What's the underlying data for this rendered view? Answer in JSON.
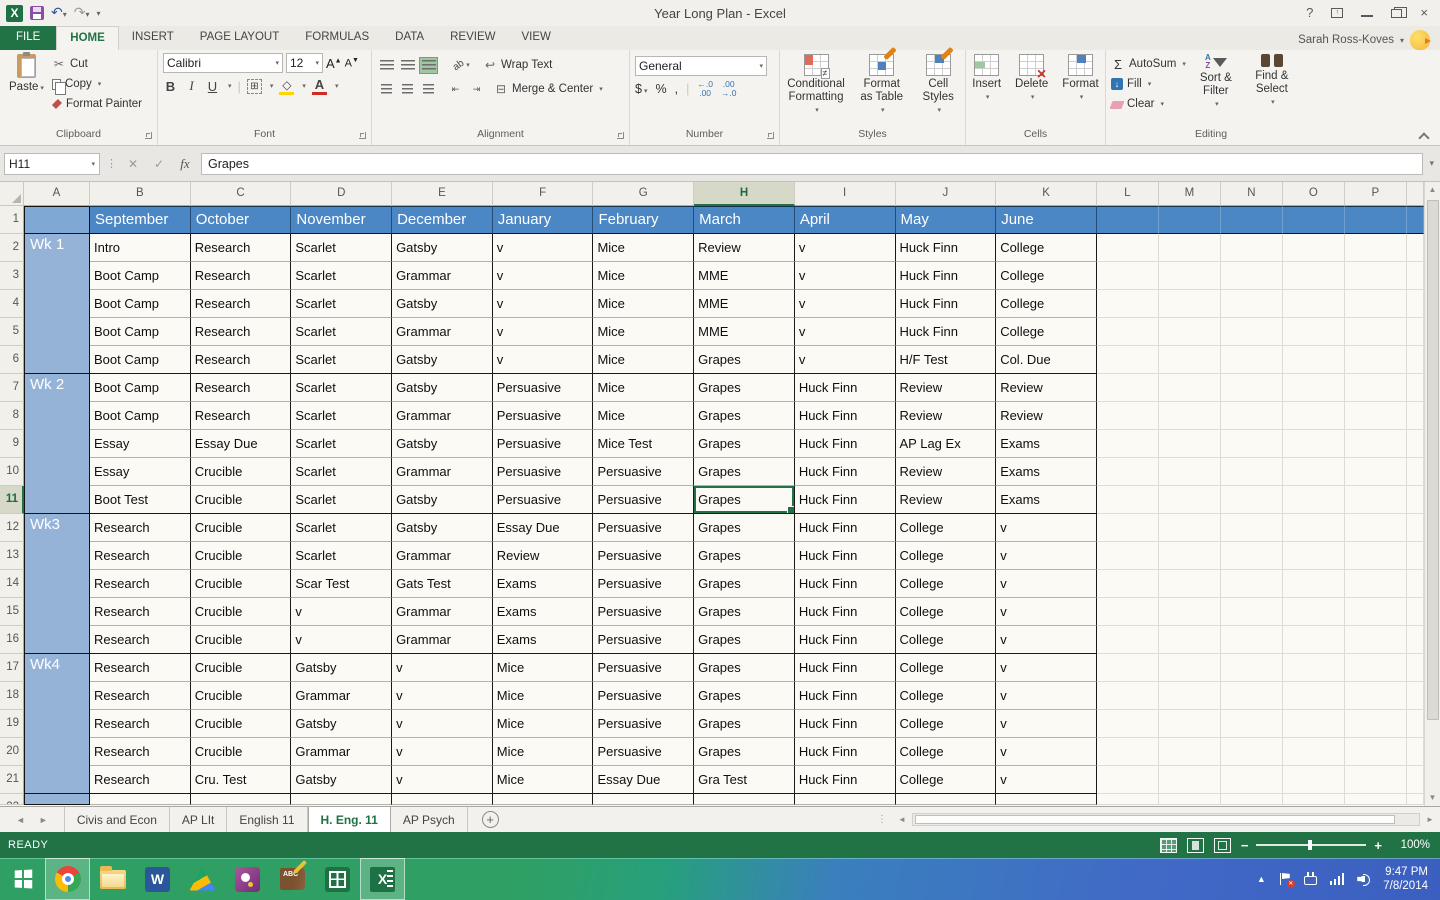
{
  "title_bar": {
    "title": "Year Long Plan - Excel",
    "help": "?",
    "user_name": "Sarah Ross-Koves"
  },
  "ribbon_tabs": {
    "file": "FILE",
    "tabs": [
      "HOME",
      "INSERT",
      "PAGE LAYOUT",
      "FORMULAS",
      "DATA",
      "REVIEW",
      "VIEW"
    ],
    "active": "HOME"
  },
  "ribbon": {
    "clipboard": {
      "label": "Clipboard",
      "paste": "Paste",
      "cut": "Cut",
      "copy": "Copy",
      "format_painter": "Format Painter"
    },
    "font": {
      "label": "Font",
      "family": "Calibri",
      "size": "12",
      "bold": "B",
      "italic": "I",
      "underline": "U"
    },
    "alignment": {
      "label": "Alignment",
      "wrap_text": "Wrap Text",
      "merge_center": "Merge & Center",
      "orientation": "ab"
    },
    "number": {
      "label": "Number",
      "format": "General",
      "currency": "$",
      "percent": "%",
      "comma": ","
    },
    "styles": {
      "label": "Styles",
      "conditional": "Conditional Formatting",
      "format_table": "Format as Table",
      "cell_styles": "Cell Styles"
    },
    "cells": {
      "label": "Cells",
      "insert": "Insert",
      "delete": "Delete",
      "format": "Format"
    },
    "editing": {
      "label": "Editing",
      "autosum": "AutoSum",
      "fill": "Fill",
      "clear": "Clear",
      "sort_filter": "Sort & Filter",
      "find_select": "Find & Select"
    }
  },
  "formula_bar": {
    "name_box": "H11",
    "value": "Grapes"
  },
  "sheet": {
    "column_letters": [
      "A",
      "B",
      "C",
      "D",
      "E",
      "F",
      "G",
      "H",
      "I",
      "J",
      "K",
      "L",
      "M",
      "N",
      "O",
      "P"
    ],
    "selected_column": "H",
    "selected_row": 11,
    "months": [
      "September",
      "October",
      "November",
      "December",
      "January",
      "February",
      "March",
      "April",
      "May",
      "June"
    ],
    "weeks": [
      {
        "label": "Wk 1",
        "rows": [
          [
            "Intro",
            "Research",
            "Scarlet",
            "Gatsby",
            "v",
            "Mice",
            "Review",
            "v",
            "Huck Finn",
            "College"
          ],
          [
            "Boot Camp",
            "Research",
            "Scarlet",
            "Grammar",
            "v",
            "Mice",
            "MME",
            "v",
            "Huck Finn",
            "College"
          ],
          [
            "Boot Camp",
            "Research",
            "Scarlet",
            "Gatsby",
            "v",
            "Mice",
            "MME",
            "v",
            "Huck Finn",
            "College"
          ],
          [
            "Boot Camp",
            "Research",
            "Scarlet",
            "Grammar",
            "v",
            "Mice",
            "MME",
            "v",
            "Huck Finn",
            "College"
          ],
          [
            "Boot Camp",
            "Research",
            "Scarlet",
            "Gatsby",
            "v",
            "Mice",
            "Grapes",
            "v",
            "H/F Test",
            "Col. Due"
          ]
        ]
      },
      {
        "label": "Wk 2",
        "rows": [
          [
            "Boot Camp",
            "Research",
            "Scarlet",
            "Gatsby",
            "Persuasive",
            "Mice",
            "Grapes",
            "Huck Finn",
            "Review",
            "Review"
          ],
          [
            "Boot Camp",
            "Research",
            "Scarlet",
            "Grammar",
            "Persuasive",
            "Mice",
            "Grapes",
            "Huck Finn",
            "Review",
            "Review"
          ],
          [
            "Essay",
            "Essay Due",
            "Scarlet",
            "Gatsby",
            "Persuasive",
            "Mice Test",
            "Grapes",
            "Huck Finn",
            "AP Lag Ex",
            "Exams"
          ],
          [
            "Essay",
            "Crucible",
            "Scarlet",
            "Grammar",
            "Persuasive",
            "Persuasive",
            "Grapes",
            "Huck Finn",
            "Review",
            "Exams"
          ],
          [
            "Boot Test",
            "Crucible",
            "Scarlet",
            "Gatsby",
            "Persuasive",
            "Persuasive",
            "Grapes",
            "Huck Finn",
            "Review",
            "Exams"
          ]
        ]
      },
      {
        "label": "Wk3",
        "rows": [
          [
            "Research",
            "Crucible",
            "Scarlet",
            "Gatsby",
            "Essay Due",
            "Persuasive",
            "Grapes",
            "Huck Finn",
            "College",
            "v"
          ],
          [
            "Research",
            "Crucible",
            "Scarlet",
            "Grammar",
            "Review",
            "Persuasive",
            "Grapes",
            "Huck Finn",
            "College",
            "v"
          ],
          [
            "Research",
            "Crucible",
            "Scar Test",
            "Gats Test",
            "Exams",
            "Persuasive",
            "Grapes",
            "Huck Finn",
            "College",
            "v"
          ],
          [
            "Research",
            "Crucible",
            "v",
            "Grammar",
            "Exams",
            "Persuasive",
            "Grapes",
            "Huck Finn",
            "College",
            "v"
          ],
          [
            "Research",
            "Crucible",
            "v",
            "Grammar",
            "Exams",
            "Persuasive",
            "Grapes",
            "Huck Finn",
            "College",
            "v"
          ]
        ]
      },
      {
        "label": "Wk4",
        "rows": [
          [
            "Research",
            "Crucible",
            "Gatsby",
            "v",
            "Mice",
            "Persuasive",
            "Grapes",
            "Huck Finn",
            "College",
            "v"
          ],
          [
            "Research",
            "Crucible",
            "Grammar",
            "v",
            "Mice",
            "Persuasive",
            "Grapes",
            "Huck Finn",
            "College",
            "v"
          ],
          [
            "Research",
            "Crucible",
            "Gatsby",
            "v",
            "Mice",
            "Persuasive",
            "Grapes",
            "Huck Finn",
            "College",
            "v"
          ],
          [
            "Research",
            "Crucible",
            "Grammar",
            "v",
            "Mice",
            "Persuasive",
            "Grapes",
            "Huck Finn",
            "College",
            "v"
          ],
          [
            "Research",
            "Cru. Test",
            "Gatsby",
            "v",
            "Mice",
            "Essay Due",
            "Gra Test",
            "Huck Finn",
            "College",
            "v"
          ]
        ]
      }
    ]
  },
  "sheet_tabs": {
    "tabs": [
      "Civis and Econ",
      "AP LIt",
      "English 11",
      "H. Eng. 11",
      "AP Psych"
    ],
    "active": "H. Eng. 11",
    "add_label": "+"
  },
  "status_bar": {
    "mode": "READY",
    "zoom": "100%"
  },
  "taskbar": {
    "icons": [
      {
        "name": "start",
        "active": false
      },
      {
        "name": "chrome",
        "active": true
      },
      {
        "name": "file-explorer",
        "active": false
      },
      {
        "name": "word",
        "active": false
      },
      {
        "name": "google-drive",
        "active": false
      },
      {
        "name": "photos-app",
        "active": false
      },
      {
        "name": "reference-book",
        "active": false
      },
      {
        "name": "calculator",
        "active": false
      },
      {
        "name": "excel",
        "active": true
      }
    ],
    "word_letter": "W",
    "excel_letter": "X",
    "clock": {
      "time": "9:47 PM",
      "date": "7/8/2014"
    }
  },
  "colors": {
    "excel_green": "#217346",
    "header_blue": "#4b86c5",
    "week_blue": "#95b3d7"
  }
}
